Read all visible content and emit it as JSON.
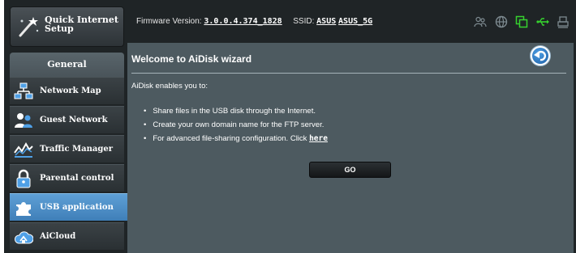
{
  "header": {
    "firmware_label": "Firmware Version:",
    "firmware_value": "3.0.0.4.374_1828",
    "ssid_label": "SSID:",
    "ssid_values": [
      "ASUS",
      "ASUS_5G"
    ],
    "status_icons": [
      "users-icon",
      "globe-icon",
      "clone-icon",
      "usb-icon",
      "printer-icon"
    ]
  },
  "sidebar": {
    "quick_setup": "Quick Internet Setup",
    "section_title": "General",
    "items": [
      {
        "label": "Network Map",
        "icon": "network-map-icon"
      },
      {
        "label": "Guest Network",
        "icon": "guest-network-icon"
      },
      {
        "label": "Traffic Manager",
        "icon": "traffic-manager-icon"
      },
      {
        "label": "Parental control",
        "icon": "lock-icon"
      },
      {
        "label": "USB application",
        "icon": "puzzle-icon",
        "active": true
      },
      {
        "label": "AiCloud",
        "icon": "cloud-house-icon"
      }
    ]
  },
  "main": {
    "title": "Welcome to AiDisk wizard",
    "intro": "AiDisk enables you to:",
    "bullets": [
      "Share files in the USB disk through the Internet.",
      "Create your own domain name for the FTP server.",
      "For advanced file-sharing configuration. Click"
    ],
    "here_link": "here",
    "go_button": "GO"
  },
  "colors": {
    "frame": "#1f2426",
    "panel": "#4d5a60",
    "active_menu": "#4a8cc6",
    "status_green": "#36d12e"
  }
}
